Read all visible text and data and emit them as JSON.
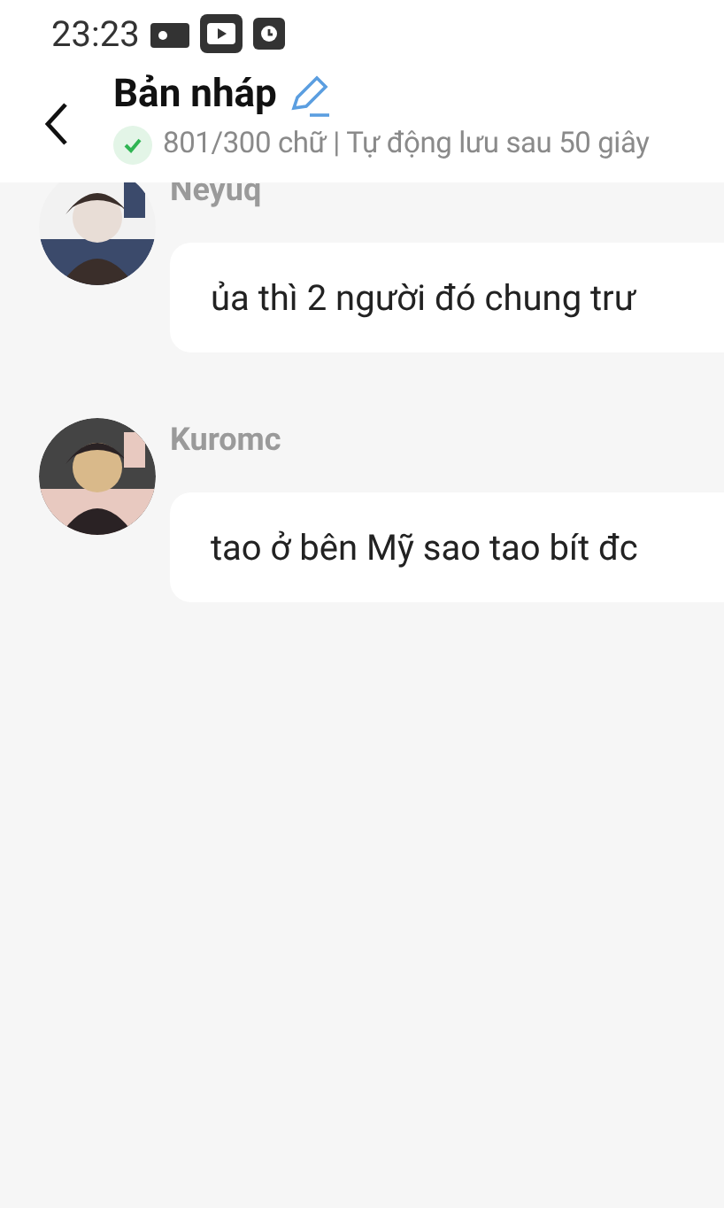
{
  "status_bar": {
    "time": "23:23"
  },
  "header": {
    "title": "Bản nháp",
    "subtitle": "801/300 chữ | Tự động lưu sau 50 giây",
    "saved": true
  },
  "messages": [
    {
      "author": "Neyuq",
      "text": "ủa thì 2 người đó chung trư"
    },
    {
      "author": "Kuromc",
      "text": "tao ở bên Mỹ sao tao bít đc"
    }
  ]
}
